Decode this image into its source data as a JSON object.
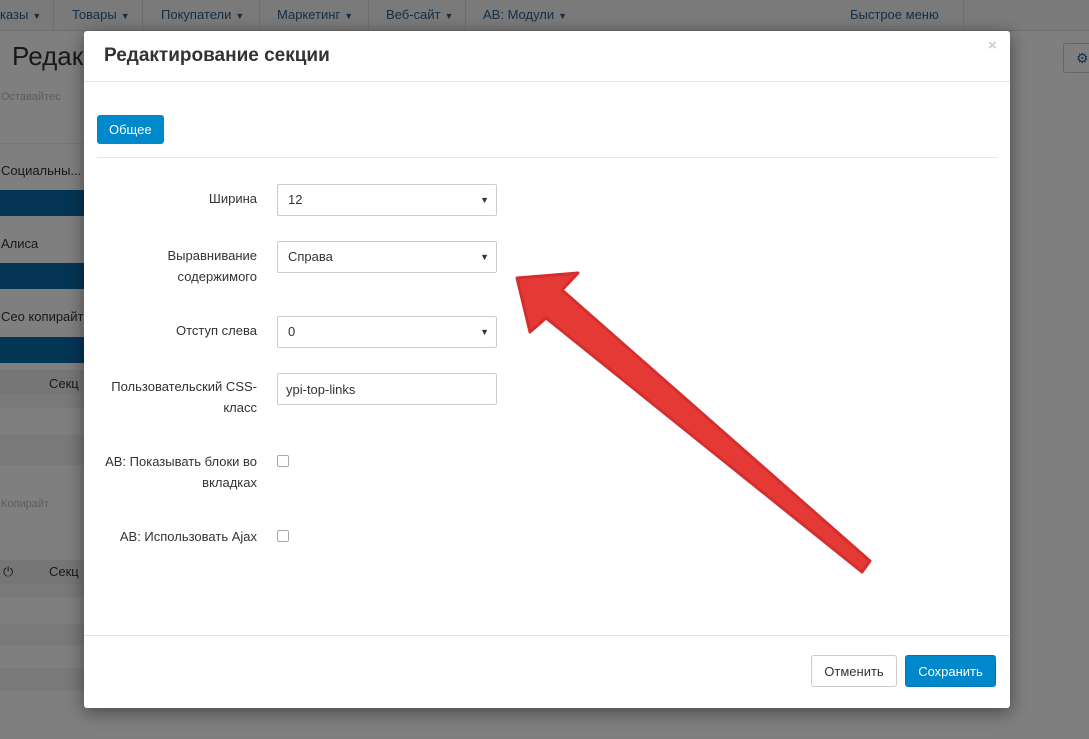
{
  "topnav": {
    "items": [
      {
        "label": "казы"
      },
      {
        "label": "Товары"
      },
      {
        "label": "Покупатели"
      },
      {
        "label": "Маркетинг"
      },
      {
        "label": "Веб-сайт"
      },
      {
        "label": "AB: Модули"
      }
    ],
    "quick_menu": "Быстрое меню"
  },
  "background": {
    "page_title": "Редакт",
    "rows": [
      {
        "label": "Оставайтес"
      },
      {
        "label": "Социальны..."
      },
      {
        "label": "Алиса"
      },
      {
        "label": "Сео копирайт"
      },
      {
        "label": "Секц"
      },
      {
        "label": "Копирайт"
      },
      {
        "label": "Секц"
      }
    ]
  },
  "modal": {
    "title": "Редактирование секции",
    "close_glyph": "×",
    "tab_general": "Общее",
    "fields": {
      "width": {
        "label": "Ширина",
        "value": "12"
      },
      "alignment": {
        "label_line1": "Выравнивание",
        "label_line2": "содержимого",
        "value": "Справа"
      },
      "offset_left": {
        "label": "Отступ слева",
        "value": "0"
      },
      "css_class": {
        "label_line1": "Пользовательский CSS-",
        "label_line2": "класс",
        "value": "ypi-top-links"
      },
      "show_blocks_tabs": {
        "label_line1": "AB: Показывать блоки во",
        "label_line2": "вкладках",
        "checked": false
      },
      "use_ajax": {
        "label": "AB: Использовать Ajax",
        "checked": false
      }
    },
    "cancel_label": "Отменить",
    "save_label": "Сохранить"
  },
  "icons": {
    "dropdown_arrow": "▼",
    "cog": "⚙",
    "power": "⏻"
  },
  "colors": {
    "primary": "#0088cc",
    "annotation_arrow": "#e53935"
  }
}
